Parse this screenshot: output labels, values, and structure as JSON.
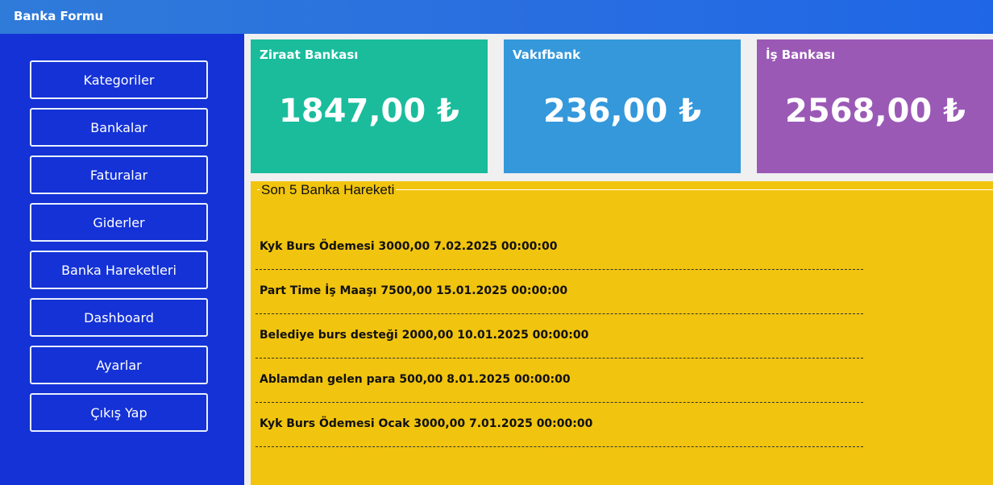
{
  "window": {
    "title": "Banka Formu"
  },
  "sidebar": {
    "items": [
      {
        "label": "Kategoriler"
      },
      {
        "label": "Bankalar"
      },
      {
        "label": "Faturalar"
      },
      {
        "label": "Giderler"
      },
      {
        "label": "Banka Hareketleri"
      },
      {
        "label": "Dashboard"
      },
      {
        "label": "Ayarlar"
      },
      {
        "label": "Çıkış Yap"
      }
    ]
  },
  "cards": [
    {
      "name": "Ziraat Bankası",
      "balance": "1847,00 ₺",
      "color": "#1abc9c"
    },
    {
      "name": "Vakıfbank",
      "balance": "236,00 ₺",
      "color": "#3498db"
    },
    {
      "name": "İş Bankası",
      "balance": "2568,00 ₺",
      "color": "#9b59b6"
    }
  ],
  "transactions": {
    "title": "Son 5 Banka Hareketi",
    "items": [
      "Kyk Burs Ödemesi 3000,00 7.02.2025 00:00:00",
      "Part Time İş Maaşı 7500,00 15.01.2025 00:00:00",
      "Belediye burs desteği 2000,00 10.01.2025 00:00:00",
      "Ablamdan gelen para 500,00 8.01.2025 00:00:00",
      "Kyk Burs Ödemesi Ocak 3000,00 7.01.2025 00:00:00"
    ]
  },
  "colors": {
    "titlebar": "#2a6fe0",
    "sidebar": "#1432d6",
    "panel": "#f1c40f"
  }
}
